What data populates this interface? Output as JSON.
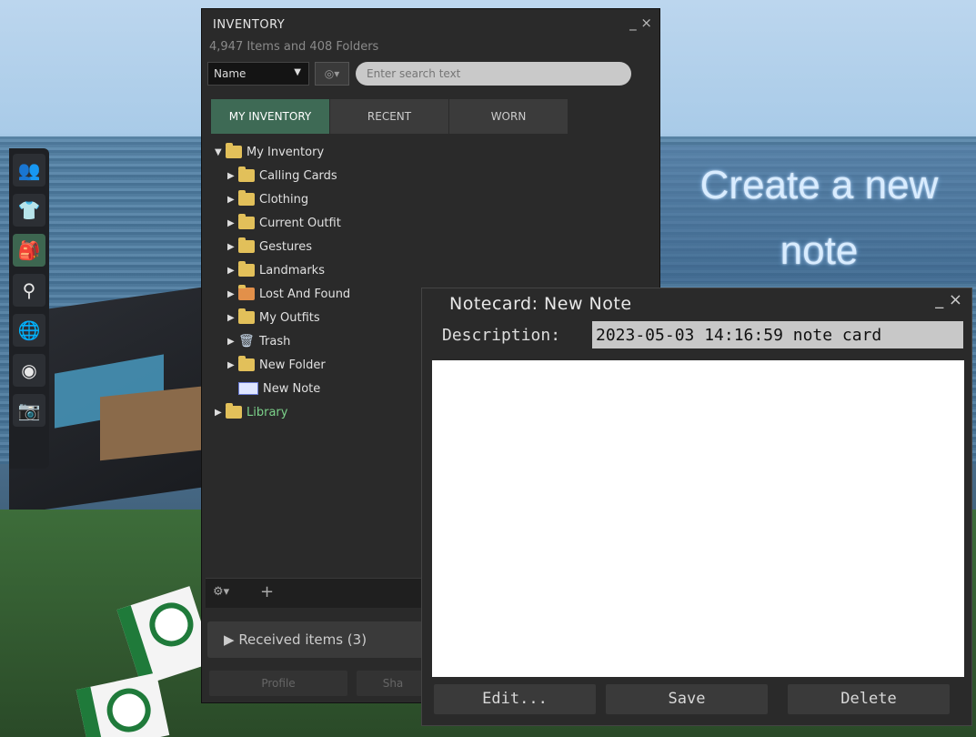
{
  "scene": {
    "sign_line1": "Create a new",
    "sign_line2": "note"
  },
  "toolbar": {
    "items": [
      {
        "icon": "people-icon",
        "glyph": "👥"
      },
      {
        "icon": "shirt-icon",
        "glyph": "👕"
      },
      {
        "icon": "inventory-icon",
        "glyph": "🎒"
      },
      {
        "icon": "search-icon",
        "glyph": "⚲"
      },
      {
        "icon": "map-icon",
        "glyph": "🌐"
      },
      {
        "icon": "signal-icon",
        "glyph": "◉"
      },
      {
        "icon": "camera-icon",
        "glyph": "📷"
      }
    ],
    "active_index": 2
  },
  "inventory": {
    "title": "INVENTORY",
    "controls": "_ ×",
    "count_label": "4,947 Items and 408 Folders",
    "sort_label": "Name",
    "search_placeholder": "Enter search text",
    "tabs": [
      "MY INVENTORY",
      "RECENT",
      "WORN"
    ],
    "active_tab": 0,
    "root": "My Inventory",
    "folders": [
      "Calling Cards",
      "Clothing",
      "Current Outfit",
      "Gestures",
      "Landmarks",
      "Lost And Found",
      "My Outfits",
      "Trash",
      "New Folder",
      "New Note"
    ],
    "library": "Library",
    "received": "Received items (3)",
    "bottom_buttons": [
      "Profile",
      "Sha"
    ]
  },
  "notecard": {
    "title": "Notecard: New Note",
    "controls": "_ ×",
    "description_label": "Description:",
    "description_value": "2023-05-03 14:16:59 note card",
    "body": "",
    "buttons": [
      "Edit...",
      "Save",
      "Delete"
    ]
  }
}
